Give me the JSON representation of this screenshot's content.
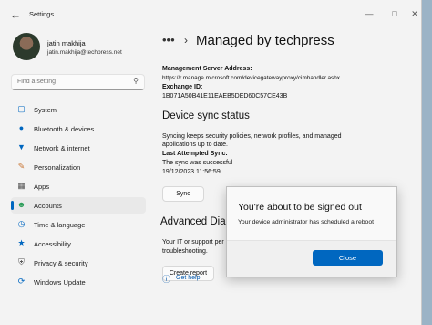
{
  "window": {
    "app_title": "Settings",
    "back_icon": "arrow-left-icon",
    "controls": [
      "minimize-icon",
      "maximize-icon",
      "close-icon"
    ]
  },
  "user": {
    "name": "jatin makhija",
    "email": "jatin.makhija@techpress.net"
  },
  "search": {
    "placeholder": "Find a setting"
  },
  "sidebar": {
    "items": [
      {
        "label": "System",
        "icon": "monitor-icon",
        "icon_color": "#0067c0"
      },
      {
        "label": "Bluetooth & devices",
        "icon": "bluetooth-icon",
        "icon_color": "#0067c0"
      },
      {
        "label": "Network & internet",
        "icon": "wifi-icon",
        "icon_color": "#0067c0"
      },
      {
        "label": "Personalization",
        "icon": "brush-icon",
        "icon_color": "#c87533"
      },
      {
        "label": "Apps",
        "icon": "apps-icon",
        "icon_color": "#555555"
      },
      {
        "label": "Accounts",
        "icon": "person-icon",
        "icon_color": "#2e9e5b",
        "active": true
      },
      {
        "label": "Time & language",
        "icon": "globe-clock-icon",
        "icon_color": "#0067c0"
      },
      {
        "label": "Accessibility",
        "icon": "accessibility-icon",
        "icon_color": "#0067c0"
      },
      {
        "label": "Privacy & security",
        "icon": "shield-icon",
        "icon_color": "#555555"
      },
      {
        "label": "Windows Update",
        "icon": "refresh-icon",
        "icon_color": "#0067c0"
      }
    ]
  },
  "main": {
    "breadcrumb_more": "•••",
    "title": "Managed by techpress",
    "mgmt_server_label": "Management Server Address:",
    "mgmt_server_value": "https://r.manage.microsoft.com/devicegatewayproxy/cimhandler.ashx",
    "exchange_label": "Exchange ID:",
    "exchange_value": "1B071A50B41E11EAEB5DED60C57CE43B",
    "sync_heading": "Device sync status",
    "sync_desc_1": "Syncing keeps security policies, network profiles, and managed",
    "sync_desc_2": "applications up to date.",
    "last_sync_label": "Last Attempted Sync:",
    "last_sync_status": "The sync was successful",
    "last_sync_time": "19/12/2023 11:56:59",
    "sync_button": "Sync",
    "advanced_heading": "Advanced Diag",
    "advanced_desc_1": "Your IT or support per",
    "advanced_desc_2": "troubleshooting.",
    "create_report_button": "Create report",
    "get_help": "Get help",
    "get_help_icon": "help-icon"
  },
  "dialog": {
    "title": "You're about to be signed out",
    "message": "Your device administrator has scheduled a reboot",
    "close_button": "Close",
    "accent_color": "#0067c0"
  }
}
